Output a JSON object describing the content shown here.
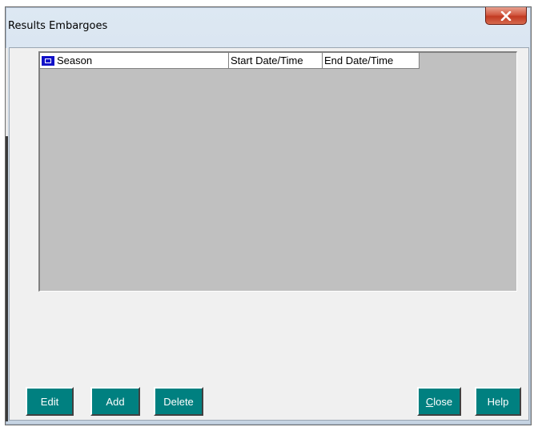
{
  "window": {
    "title": "Results Embargoes",
    "close_symbol": "×"
  },
  "grid": {
    "columns": [
      {
        "label": "Season",
        "icon": "grid-select-icon"
      },
      {
        "label": "Start Date/Time"
      },
      {
        "label": "End Date/Time"
      }
    ],
    "rows": []
  },
  "buttons": {
    "edit": "Edit",
    "add": "Add",
    "delete": "Delete",
    "close_mnemonic": "C",
    "close_rest": "lose",
    "help": "Help"
  },
  "colors": {
    "button_bg": "#008080",
    "grid_bg": "#c0c0c0",
    "close_button": "#c74a30"
  }
}
